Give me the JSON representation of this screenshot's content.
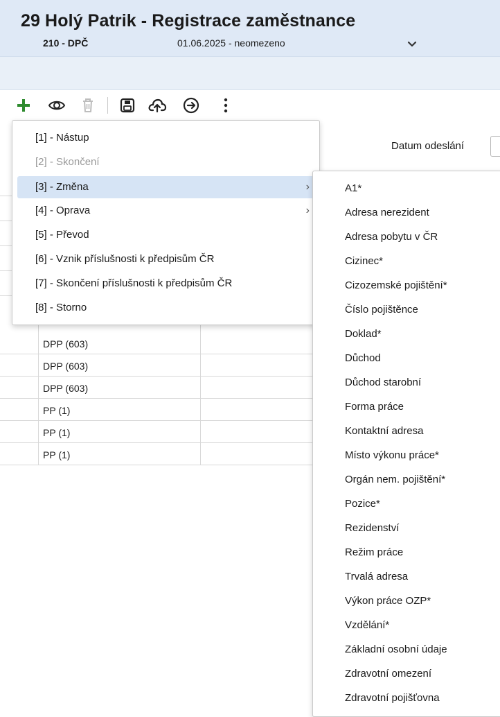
{
  "header": {
    "title": "29 Holý Patrik - Registrace zaměstnance",
    "code": "210 - DPČ",
    "date_range": "01.06.2025 - neomezeno"
  },
  "toolbar": {
    "icons": [
      "plus-icon",
      "eye-icon",
      "trash-icon",
      "save-icon",
      "cloud-upload-icon",
      "arrow-right-circle-icon",
      "more-vertical-icon"
    ],
    "accent_color": "#2e8b2e"
  },
  "background": {
    "send_date_label": "Datum odeslání",
    "rows": [
      "DPP (603)",
      "DPP (603)",
      "DPP (603)",
      "PP (1)",
      "PP (1)",
      "PP (1)"
    ]
  },
  "menu": {
    "items": [
      {
        "label": "[1] - Nástup"
      },
      {
        "label": "[2] - Skončení"
      },
      {
        "label": "[3] - Změna"
      },
      {
        "label": "[4] - Oprava"
      },
      {
        "label": "[5] - Převod"
      },
      {
        "label": "[6] - Vznik příslušnosti k předpisům ČR"
      },
      {
        "label": "[7] - Skončení příslušnosti k předpisům ČR"
      },
      {
        "label": "[8] - Storno"
      }
    ]
  },
  "submenu": {
    "items": [
      "A1*",
      "Adresa nerezident",
      "Adresa pobytu v ČR",
      "Cizinec*",
      "Cizozemské pojištění*",
      "Číslo pojištěnce",
      "Doklad*",
      "Důchod",
      "Důchod starobní",
      "Forma práce",
      "Kontaktní adresa",
      "Místo výkonu práce*",
      "Orgán nem. pojištění*",
      "Pozice*",
      "Rezidenství",
      "Režim práce",
      "Trvalá adresa",
      "Výkon práce OZP*",
      "Vzdělání*",
      "Základní osobní údaje",
      "Zdravotní omezení",
      "Zdravotní pojišťovna"
    ]
  }
}
